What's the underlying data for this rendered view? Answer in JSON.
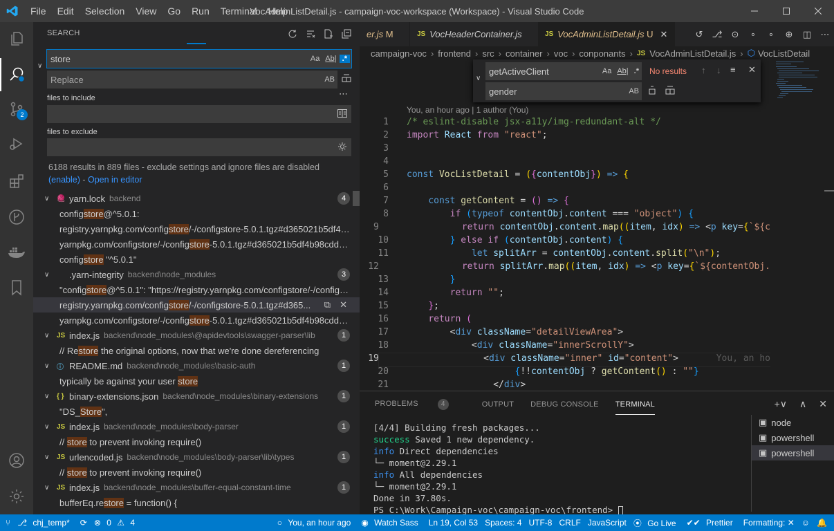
{
  "titlebar": {
    "menu": [
      "File",
      "Edit",
      "Selection",
      "View",
      "Go",
      "Run",
      "Terminal",
      "Help"
    ],
    "title": "VocAdminListDetail.js - campaign-voc-workspace (Workspace) - Visual Studio Code"
  },
  "activity": {
    "scm_badge": "2"
  },
  "search": {
    "header": "SEARCH",
    "query": "store",
    "replace_placeholder": "Replace",
    "opt_case": "Aa",
    "opt_word": "Ab|",
    "opt_regex": ".*",
    "opt_preserve": "AB",
    "files_include_label": "files to include",
    "files_exclude_label": "files to exclude",
    "summary": "6188 results in 889 files - exclude settings and ignore files are disabled",
    "enable_link": "(enable)",
    "dash": " - ",
    "open_editor_link": "Open in editor",
    "results": [
      {
        "type": "file",
        "icon": "yarn",
        "name": "yarn.lock",
        "path": "backend",
        "count": "4"
      },
      {
        "type": "match",
        "pre": "config",
        "hit": "store",
        "post": "@^5.0.1:"
      },
      {
        "type": "match",
        "pre": "registry.yarnpkg.com/config",
        "hit": "store",
        "post": "/-/configstore-5.0.1.tgz#d365021b5df4b..."
      },
      {
        "type": "match",
        "pre": "yarnpkg.com/configstore/-/config",
        "hit": "store",
        "post": "-5.0.1.tgz#d365021b5df4b98cdd18..."
      },
      {
        "type": "match",
        "pre": "config",
        "hit": "store",
        "post": " \"^5.0.1\""
      },
      {
        "type": "file",
        "icon": "none",
        "name": ".yarn-integrity",
        "path": "backend\\node_modules",
        "count": "3"
      },
      {
        "type": "match",
        "pre": "\"config",
        "hit": "store",
        "post": "@^5.0.1\": \"https://registry.yarnpkg.com/configstore/-/configs..."
      },
      {
        "type": "match",
        "pre": "registry.yarnpkg.com/config",
        "hit": "store",
        "post": "/-/configstore-5.0.1.tgz#d365...",
        "selected": true
      },
      {
        "type": "match",
        "pre": "yarnpkg.com/configstore/-/config",
        "hit": "store",
        "post": "-5.0.1.tgz#d365021b5df4b98cdd18..."
      },
      {
        "type": "file",
        "icon": "JS",
        "name": "index.js",
        "path": "backend\\node_modules\\@apidevtools\\swagger-parser\\lib",
        "count": "1"
      },
      {
        "type": "match",
        "pre": "// Re",
        "hit": "store",
        "post": " the original options, now that we're done dereferencing"
      },
      {
        "type": "file",
        "icon": "info",
        "name": "README.md",
        "path": "backend\\node_modules\\basic-auth",
        "count": "1"
      },
      {
        "type": "match",
        "pre": "typically be against your user ",
        "hit": "store",
        "post": ""
      },
      {
        "type": "file",
        "icon": "{}",
        "name": "binary-extensions.json",
        "path": "backend\\node_modules\\binary-extensions",
        "count": "1"
      },
      {
        "type": "match",
        "pre": "\"DS_",
        "hit": "Store",
        "post": "\","
      },
      {
        "type": "file",
        "icon": "JS",
        "name": "index.js",
        "path": "backend\\node_modules\\body-parser",
        "count": "1"
      },
      {
        "type": "match",
        "pre": "// ",
        "hit": "store",
        "post": " to prevent invoking require()"
      },
      {
        "type": "file",
        "icon": "JS",
        "name": "urlencoded.js",
        "path": "backend\\node_modules\\body-parser\\lib\\types",
        "count": "1"
      },
      {
        "type": "match",
        "pre": "// ",
        "hit": "store",
        "post": " to prevent invoking require()"
      },
      {
        "type": "file",
        "icon": "JS",
        "name": "index.js",
        "path": "backend\\node_modules\\buffer-equal-constant-time",
        "count": "1"
      },
      {
        "type": "match",
        "pre": "bufferEq.re",
        "hit": "store",
        "post": " = function() {"
      }
    ]
  },
  "tabs": [
    {
      "label": "er.js",
      "status": "M"
    },
    {
      "label": "VocHeaderContainer.js",
      "status": ""
    },
    {
      "label": "VocAdminListDetail.js",
      "status": "U"
    }
  ],
  "breadcrumb": [
    "campaign-voc",
    "frontend",
    "src",
    "container",
    "voc",
    "conponants",
    "VocAdminListDetail.js",
    "VocListDetail"
  ],
  "find_widget": {
    "find_value": "getActiveClient",
    "replace_value": "gender",
    "no_results": "No results"
  },
  "editor": {
    "blame_header": "You, an hour ago | 1 author (You)",
    "inline_blame": "You, an ho",
    "current_line": 19,
    "line_numbers": [
      "1",
      "2",
      "3",
      "4",
      "5",
      "6",
      "7",
      "8",
      "9",
      "10",
      "11",
      "12",
      "13",
      "14",
      "15",
      "16",
      "17",
      "18",
      "19",
      "20",
      "21"
    ]
  },
  "panel": {
    "tabs": [
      "PROBLEMS",
      "OUTPUT",
      "DEBUG CONSOLE",
      "TERMINAL"
    ],
    "problems_count": "4",
    "terminal_lines": [
      {
        "kind": "plain",
        "text": "[4/4] Building fresh packages..."
      },
      {
        "kind": "success",
        "prefix": "success",
        "text": " Saved 1 new dependency."
      },
      {
        "kind": "info",
        "prefix": "info",
        "text": " Direct dependencies"
      },
      {
        "kind": "plain",
        "text": "└─ moment@2.29.1"
      },
      {
        "kind": "info",
        "prefix": "info",
        "text": " All dependencies"
      },
      {
        "kind": "plain",
        "text": "└─ moment@2.29.1"
      },
      {
        "kind": "plain",
        "text": "Done in 37.80s."
      },
      {
        "kind": "prompt",
        "text": "PS C:\\Work\\Campaign-voc\\campaign-voc\\frontend> "
      }
    ],
    "terminals": [
      "node",
      "powershell",
      "powershell"
    ]
  },
  "statusbar": {
    "branch": "chj_temp*",
    "errors": "0",
    "warnings": "4",
    "blame": "You, an hour ago",
    "watch_sass": "Watch Sass",
    "position": "Ln 19, Col 53",
    "spaces": "Spaces: 4",
    "encoding": "UTF-8",
    "eol": "CRLF",
    "language": "JavaScript",
    "golive": "Go Live",
    "prettier": "Prettier",
    "formatting": "Formatting: ✕"
  },
  "colors": {
    "accent": "#007acc",
    "match_highlight": "#613214",
    "titlebar": "#3c3c3c",
    "sidebar": "#252526",
    "editor": "#1e1e1e"
  }
}
